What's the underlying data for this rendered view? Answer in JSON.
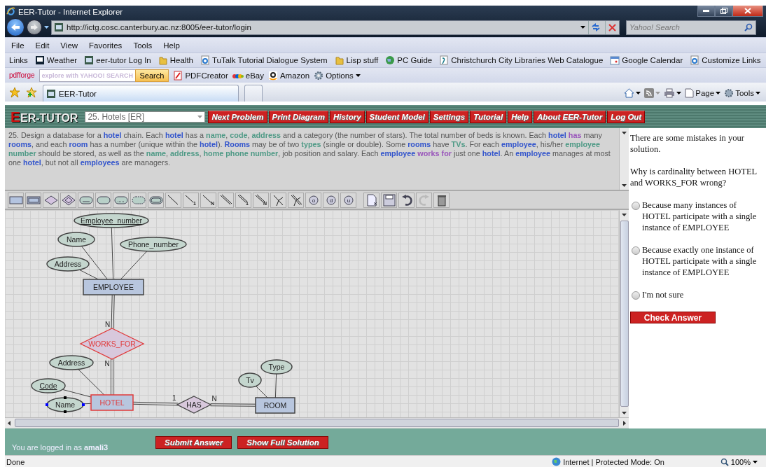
{
  "window": {
    "title": "EER-Tutor - Internet Explorer"
  },
  "address_bar": {
    "url": "http://ictg.cosc.canterbury.ac.nz:8005/eer-tutor/login"
  },
  "search_box": {
    "placeholder": "Yahoo! Search"
  },
  "menu_bar": [
    "File",
    "Edit",
    "View",
    "Favorites",
    "Tools",
    "Help"
  ],
  "links_bar": {
    "label": "Links",
    "items": [
      {
        "label": "Weather",
        "kind": "tv"
      },
      {
        "label": "eer-tutor Log In",
        "kind": "eer"
      },
      {
        "label": "Health",
        "kind": "folder"
      },
      {
        "label": "TuTalk Tutorial Dialogue System",
        "kind": "ie"
      },
      {
        "label": "Lisp stuff",
        "kind": "folder"
      },
      {
        "label": "PC Guide",
        "kind": "globe"
      },
      {
        "label": "Christchurch City Libraries Web Catalogue",
        "kind": "page"
      },
      {
        "label": "Google Calendar",
        "kind": "calendar"
      },
      {
        "label": "Customize Links",
        "kind": "ie"
      }
    ]
  },
  "search_toolbar": {
    "logo": "pdfforge",
    "placeholder": "explore with YAHOO! SEARCH",
    "button": "Search",
    "items": [
      {
        "label": "PDFCreator",
        "kind": "pdf"
      },
      {
        "label": "eBay",
        "kind": "ebay"
      },
      {
        "label": "Amazon",
        "kind": "amazon"
      },
      {
        "label": "Options",
        "kind": "gear"
      }
    ]
  },
  "tabs": [
    {
      "label": "EER-Tutor",
      "selected": true
    }
  ],
  "command_bar": [
    "Page",
    "Tools"
  ],
  "app": {
    "logo": "EER-TUTOR",
    "problem_select": "25. Hotels [ER]",
    "nav_buttons": [
      "Next Problem",
      "Print Diagram",
      "History",
      "Student Model",
      "Settings",
      "Tutorial",
      "Help",
      "About EER-Tutor",
      "Log Out"
    ],
    "problem_text": [
      {
        "text": "25. Design a database for a ",
        "kind": "plain"
      },
      {
        "text": "hotel",
        "kind": "entity"
      },
      {
        "text": " chain. Each ",
        "kind": "plain"
      },
      {
        "text": "hotel",
        "kind": "entity"
      },
      {
        "text": " has a ",
        "kind": "plain"
      },
      {
        "text": "name",
        "kind": "attribute"
      },
      {
        "text": ", ",
        "kind": "plain"
      },
      {
        "text": "code",
        "kind": "attribute"
      },
      {
        "text": ", ",
        "kind": "plain"
      },
      {
        "text": "address",
        "kind": "attribute"
      },
      {
        "text": " and a category (the number of stars). The total number of beds is known. Each ",
        "kind": "plain"
      },
      {
        "text": "hotel ",
        "kind": "entity"
      },
      {
        "text": "has",
        "kind": "relationship"
      },
      {
        "text": " many ",
        "kind": "plain"
      },
      {
        "text": "rooms",
        "kind": "entity"
      },
      {
        "text": ", and each ",
        "kind": "plain"
      },
      {
        "text": "room",
        "kind": "entity"
      },
      {
        "text": " has a number (unique within the ",
        "kind": "plain"
      },
      {
        "text": "hotel",
        "kind": "entity"
      },
      {
        "text": "). ",
        "kind": "plain"
      },
      {
        "text": "Rooms",
        "kind": "entity"
      },
      {
        "text": " may be of two ",
        "kind": "plain"
      },
      {
        "text": "types",
        "kind": "attribute"
      },
      {
        "text": " (single or double). Some ",
        "kind": "plain"
      },
      {
        "text": "rooms",
        "kind": "entity"
      },
      {
        "text": " have ",
        "kind": "plain"
      },
      {
        "text": "TVs",
        "kind": "attribute"
      },
      {
        "text": ". For each ",
        "kind": "plain"
      },
      {
        "text": "employee",
        "kind": "entity"
      },
      {
        "text": ", his/her ",
        "kind": "plain"
      },
      {
        "text": "employee number",
        "kind": "attribute"
      },
      {
        "text": " should be stored, as well as the ",
        "kind": "plain"
      },
      {
        "text": "name",
        "kind": "attribute"
      },
      {
        "text": ", ",
        "kind": "plain"
      },
      {
        "text": "address",
        "kind": "attribute"
      },
      {
        "text": ", ",
        "kind": "plain"
      },
      {
        "text": "home phone number",
        "kind": "attribute"
      },
      {
        "text": ", job position and salary. Each ",
        "kind": "plain"
      },
      {
        "text": "employee ",
        "kind": "entity"
      },
      {
        "text": "works for",
        "kind": "relationship"
      },
      {
        "text": " just one ",
        "kind": "plain"
      },
      {
        "text": "hotel",
        "kind": "entity"
      },
      {
        "text": ". An ",
        "kind": "plain"
      },
      {
        "text": "employee",
        "kind": "entity"
      },
      {
        "text": " manages at most one ",
        "kind": "plain"
      },
      {
        "text": "hotel",
        "kind": "entity"
      },
      {
        "text": ", but not all ",
        "kind": "plain"
      },
      {
        "text": "employees",
        "kind": "entity"
      },
      {
        "text": " are managers.",
        "kind": "plain"
      }
    ],
    "palette": [
      {
        "kind": "entity"
      },
      {
        "kind": "weak_entity"
      },
      {
        "kind": "relationship"
      },
      {
        "kind": "identifying_relationship"
      },
      {
        "kind": "key_attribute"
      },
      {
        "kind": "attribute"
      },
      {
        "kind": "partial_key"
      },
      {
        "kind": "derived"
      },
      {
        "kind": "multivalued"
      },
      {
        "kind": "line"
      },
      {
        "kind": "line",
        "glyph": "1"
      },
      {
        "kind": "line",
        "glyph": "N"
      },
      {
        "kind": "double_line"
      },
      {
        "kind": "double_line",
        "glyph": "1"
      },
      {
        "kind": "double_line",
        "glyph": "N"
      },
      {
        "kind": "fork"
      },
      {
        "kind": "double_fork"
      },
      {
        "kind": "circle",
        "glyph": "o"
      },
      {
        "kind": "circle",
        "glyph": "d"
      },
      {
        "kind": "circle",
        "glyph": "u"
      },
      {
        "kind": "new"
      },
      {
        "kind": "save"
      },
      {
        "kind": "undo",
        "disabled": false
      },
      {
        "kind": "redo",
        "disabled": true
      },
      {
        "kind": "delete"
      }
    ],
    "diagram": {
      "nodes": [
        {
          "kind": "key_attribute",
          "label": "Employee_number",
          "error": false,
          "selected": false
        },
        {
          "kind": "attribute",
          "label": "Name",
          "error": false,
          "selected": false
        },
        {
          "kind": "attribute",
          "label": "Phone_number",
          "error": false,
          "selected": false
        },
        {
          "kind": "attribute",
          "label": "Address",
          "error": false,
          "selected": false
        },
        {
          "kind": "entity",
          "label": "EMPLOYEE",
          "error": false,
          "selected": false
        },
        {
          "kind": "relationship",
          "label": "WORKS_FOR",
          "error": true,
          "selected": false
        },
        {
          "kind": "attribute",
          "label": "Address",
          "error": false,
          "selected": false
        },
        {
          "kind": "key_attribute",
          "label": "Code",
          "error": false,
          "selected": false
        },
        {
          "kind": "attribute",
          "label": "Name",
          "error": false,
          "selected": true
        },
        {
          "kind": "entity",
          "label": "HOTEL",
          "error": true,
          "selected": false
        },
        {
          "kind": "relationship",
          "label": "HAS",
          "error": false,
          "selected": false
        },
        {
          "kind": "entity",
          "label": "ROOM",
          "error": false,
          "selected": false
        },
        {
          "kind": "attribute",
          "label": "Tv",
          "error": false,
          "selected": false
        },
        {
          "kind": "attribute",
          "label": "Type",
          "error": false,
          "selected": false
        }
      ],
      "edges": [
        {
          "double": false
        },
        {
          "double": false
        },
        {
          "double": false
        },
        {
          "double": false
        },
        {
          "double": true,
          "cardinality": "N"
        },
        {
          "double": true,
          "cardinality": "N"
        },
        {
          "double": false
        },
        {
          "double": false
        },
        {
          "double": false
        },
        {
          "double": true,
          "cardinality": "1"
        },
        {
          "double": true,
          "cardinality": "N"
        },
        {
          "double": false
        },
        {
          "double": false
        }
      ]
    },
    "feedback": {
      "message": "There are some mistakes in your solution.",
      "question": "Why is cardinality between HOTEL and WORKS_FOR wrong?",
      "options": [
        {
          "label": "Because many instances of HOTEL participate with a single instance of EMPLOYEE",
          "selected": false
        },
        {
          "label": "Because exactly one instance of HOTEL participate with a single instance of EMPLOYEE",
          "selected": false
        },
        {
          "label": "I'm not sure",
          "selected": false
        }
      ],
      "button": "Check Answer"
    },
    "footer": {
      "login": "You are logged in as **amali3**",
      "buttons": [
        "Submit Answer",
        "Show Full Solution"
      ]
    }
  },
  "status_bar": {
    "text": "Done",
    "zone": "Internet | Protected Mode: On",
    "zoom": "100%"
  }
}
